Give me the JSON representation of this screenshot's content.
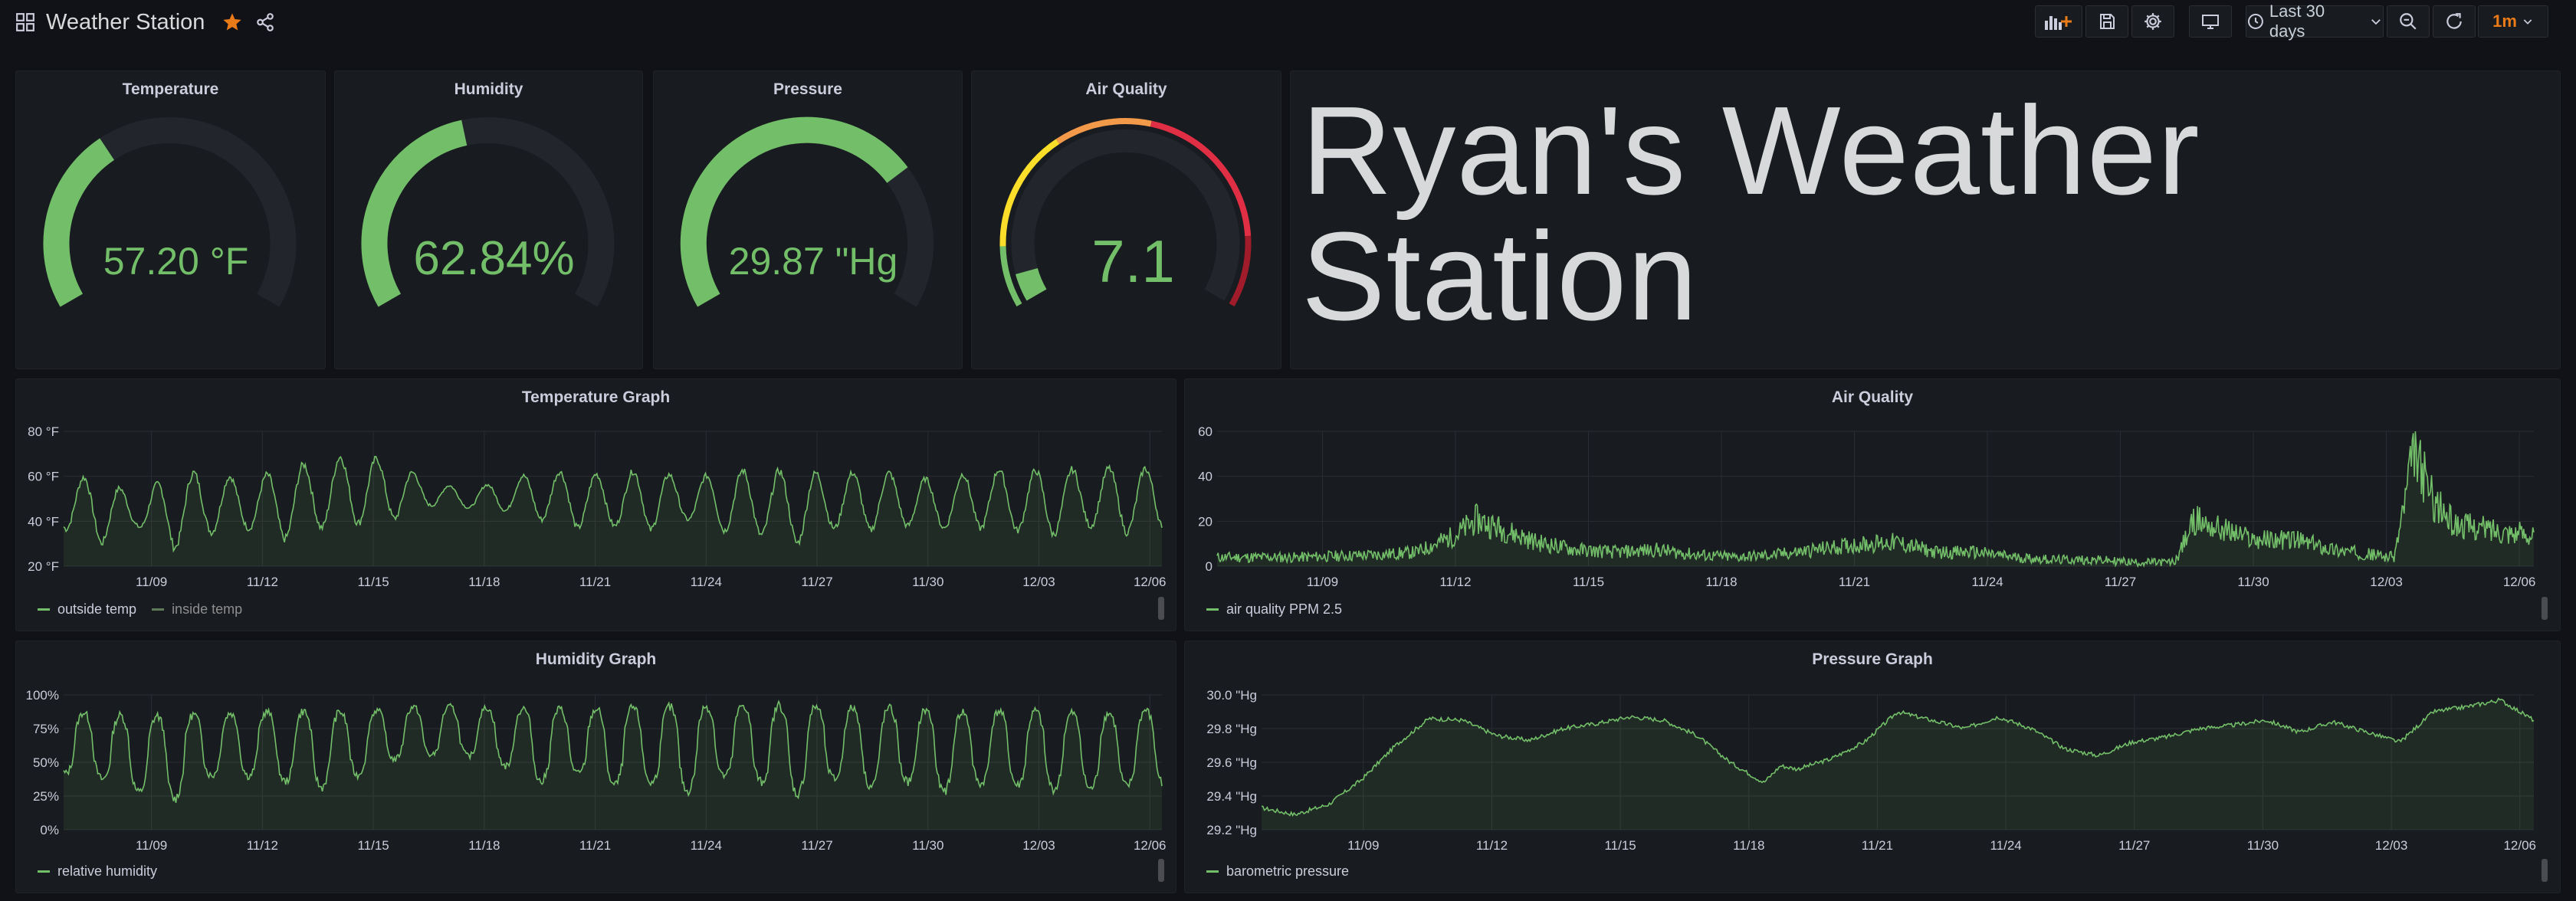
{
  "app": {
    "dashboard_title": "Weather Station",
    "starred": true,
    "accent_color": "#eb7b18"
  },
  "toolbar": {
    "time_range_label": "Last 30 days",
    "refresh_interval_label": "1m",
    "icons": [
      "add-panel-icon",
      "save-icon",
      "settings-icon",
      "tv-mode-icon",
      "clock-icon",
      "chevron-down-icon",
      "zoom-out-icon",
      "refresh-icon"
    ]
  },
  "gauges": [
    {
      "title": "Temperature",
      "value": 57.2,
      "display": "57.20 °F",
      "fill_fraction": 0.36,
      "color": "#73bf69"
    },
    {
      "title": "Humidity",
      "value": 62.84,
      "display": "62.84%",
      "fill_fraction": 0.45,
      "color": "#73bf69"
    },
    {
      "title": "Pressure",
      "value": 29.87,
      "display": "29.87 \"Hg",
      "fill_fraction": 0.72,
      "color": "#73bf69"
    },
    {
      "title": "Air Quality",
      "value": 7.1,
      "display": "7.1",
      "fill_fraction": 0.06,
      "color": "#73bf69",
      "thresholds": [
        "#73bf69",
        "#fade2a",
        "#f2994a",
        "#e02f44",
        "#a01c2a"
      ]
    }
  ],
  "text_panel": {
    "text": "Ryan's Weather Station"
  },
  "chart_data": [
    {
      "type": "area",
      "title": "Temperature Graph",
      "y_ticks": [
        "80 °F",
        "60 °F",
        "40 °F",
        "20 °F"
      ],
      "ylim": [
        20,
        80
      ],
      "x_ticks": [
        "11/09",
        "11/12",
        "11/15",
        "11/18",
        "11/21",
        "11/24",
        "11/27",
        "11/30",
        "12/03",
        "12/06"
      ],
      "x_range_days": [
        0,
        30
      ],
      "grid": true,
      "legend_position": "bottom-left",
      "series": [
        {
          "name": "outside temp",
          "color": "#73bf69",
          "daily_min": [
            37,
            30,
            38,
            28,
            35,
            37,
            32,
            37,
            39,
            41,
            47,
            46,
            45,
            41,
            37,
            38,
            36,
            41,
            36,
            34,
            30,
            37,
            36,
            38,
            37,
            37,
            36,
            34,
            38,
            35,
            37
          ],
          "daily_max": [
            60,
            59,
            51,
            61,
            62,
            58,
            63,
            67,
            70,
            66,
            58,
            54,
            58,
            62,
            62,
            60,
            64,
            58,
            62,
            63,
            62,
            61,
            62,
            61,
            57,
            64,
            62,
            63,
            63,
            64,
            63
          ]
        },
        {
          "name": "inside temp",
          "color": "#5f7a58",
          "hidden": true
        }
      ]
    },
    {
      "type": "area",
      "title": "Air Quality",
      "y_ticks": [
        "60",
        "40",
        "20",
        "0"
      ],
      "ylim": [
        0,
        60
      ],
      "x_ticks": [
        "11/09",
        "11/12",
        "11/15",
        "11/18",
        "11/21",
        "11/24",
        "11/27",
        "11/30",
        "12/03",
        "12/06"
      ],
      "x_range_days": [
        0,
        30
      ],
      "grid": true,
      "legend_position": "bottom-left",
      "series": [
        {
          "name": "air quality PPM 2.5",
          "color": "#73bf69",
          "keypoints": [
            [
              0,
              3
            ],
            [
              2,
              3
            ],
            [
              4,
              4
            ],
            [
              5,
              5
            ],
            [
              6,
              12
            ],
            [
              6.5,
              18
            ],
            [
              7,
              15
            ],
            [
              8,
              9
            ],
            [
              9,
              6
            ],
            [
              10,
              5
            ],
            [
              11,
              6
            ],
            [
              12,
              4
            ],
            [
              13,
              3
            ],
            [
              14,
              4
            ],
            [
              15,
              6
            ],
            [
              16,
              8
            ],
            [
              17,
              9
            ],
            [
              18,
              5
            ],
            [
              19,
              5
            ],
            [
              20,
              3
            ],
            [
              21,
              2
            ],
            [
              22,
              2
            ],
            [
              23,
              1
            ],
            [
              24,
              1
            ],
            [
              24.5,
              18
            ],
            [
              25,
              15
            ],
            [
              26,
              10
            ],
            [
              27,
              10
            ],
            [
              28,
              6
            ],
            [
              29,
              4
            ],
            [
              29.5,
              3
            ],
            [
              30,
              45
            ],
            [
              30.5,
              25
            ],
            [
              31,
              16
            ],
            [
              32,
              14
            ],
            [
              33,
              12
            ]
          ]
        }
      ]
    },
    {
      "type": "area",
      "title": "Humidity Graph",
      "y_ticks": [
        "100%",
        "75%",
        "50%",
        "25%",
        "0%"
      ],
      "ylim": [
        0,
        100
      ],
      "x_ticks": [
        "11/09",
        "11/12",
        "11/15",
        "11/18",
        "11/21",
        "11/24",
        "11/27",
        "11/30",
        "12/03",
        "12/06"
      ],
      "x_range_days": [
        0,
        30
      ],
      "grid": true,
      "legend_position": "bottom-left",
      "series": [
        {
          "name": "relative humidity",
          "color": "#73bf69",
          "daily_max": [
            88,
            86,
            84,
            85,
            86,
            87,
            88,
            88,
            87,
            90,
            92,
            91,
            90,
            90,
            89,
            90,
            91,
            91,
            92,
            93,
            92,
            91,
            90,
            90,
            88,
            87,
            89,
            87,
            86,
            87,
            90
          ],
          "daily_min": [
            42,
            38,
            28,
            22,
            40,
            40,
            36,
            31,
            40,
            52,
            55,
            55,
            48,
            35,
            42,
            33,
            35,
            28,
            40,
            36,
            26,
            38,
            32,
            36,
            28,
            34,
            33,
            30,
            30,
            32,
            35
          ]
        }
      ]
    },
    {
      "type": "area",
      "title": "Pressure Graph",
      "y_ticks": [
        "30.0 \"Hg",
        "29.8 \"Hg",
        "29.6 \"Hg",
        "29.4 \"Hg",
        "29.2 \"Hg"
      ],
      "ylim": [
        29.2,
        30.0
      ],
      "x_ticks": [
        "11/09",
        "11/12",
        "11/15",
        "11/18",
        "11/21",
        "11/24",
        "11/27",
        "11/30",
        "12/03",
        "12/06"
      ],
      "x_range_days": [
        0,
        30
      ],
      "grid": true,
      "legend_position": "bottom-left",
      "series": [
        {
          "name": "barometric pressure",
          "color": "#73bf69",
          "keypoints": [
            [
              0,
              29.33
            ],
            [
              1,
              29.29
            ],
            [
              2,
              29.35
            ],
            [
              3,
              29.5
            ],
            [
              4,
              29.7
            ],
            [
              5,
              29.86
            ],
            [
              6,
              29.85
            ],
            [
              7,
              29.76
            ],
            [
              8,
              29.73
            ],
            [
              9,
              29.8
            ],
            [
              10,
              29.83
            ],
            [
              11,
              29.87
            ],
            [
              12,
              29.85
            ],
            [
              13,
              29.76
            ],
            [
              14,
              29.6
            ],
            [
              15,
              29.48
            ],
            [
              15.5,
              29.58
            ],
            [
              16,
              29.56
            ],
            [
              17,
              29.62
            ],
            [
              18,
              29.72
            ],
            [
              19,
              29.9
            ],
            [
              20,
              29.85
            ],
            [
              21,
              29.8
            ],
            [
              22,
              29.87
            ],
            [
              23,
              29.8
            ],
            [
              24,
              29.68
            ],
            [
              25,
              29.64
            ],
            [
              26,
              29.72
            ],
            [
              27,
              29.75
            ],
            [
              28,
              29.8
            ],
            [
              29,
              29.82
            ],
            [
              30,
              29.85
            ],
            [
              31,
              29.78
            ],
            [
              32,
              29.84
            ],
            [
              33,
              29.78
            ],
            [
              34,
              29.72
            ],
            [
              35,
              29.9
            ],
            [
              36,
              29.93
            ],
            [
              37,
              29.97
            ],
            [
              38,
              29.85
            ]
          ]
        }
      ]
    }
  ]
}
